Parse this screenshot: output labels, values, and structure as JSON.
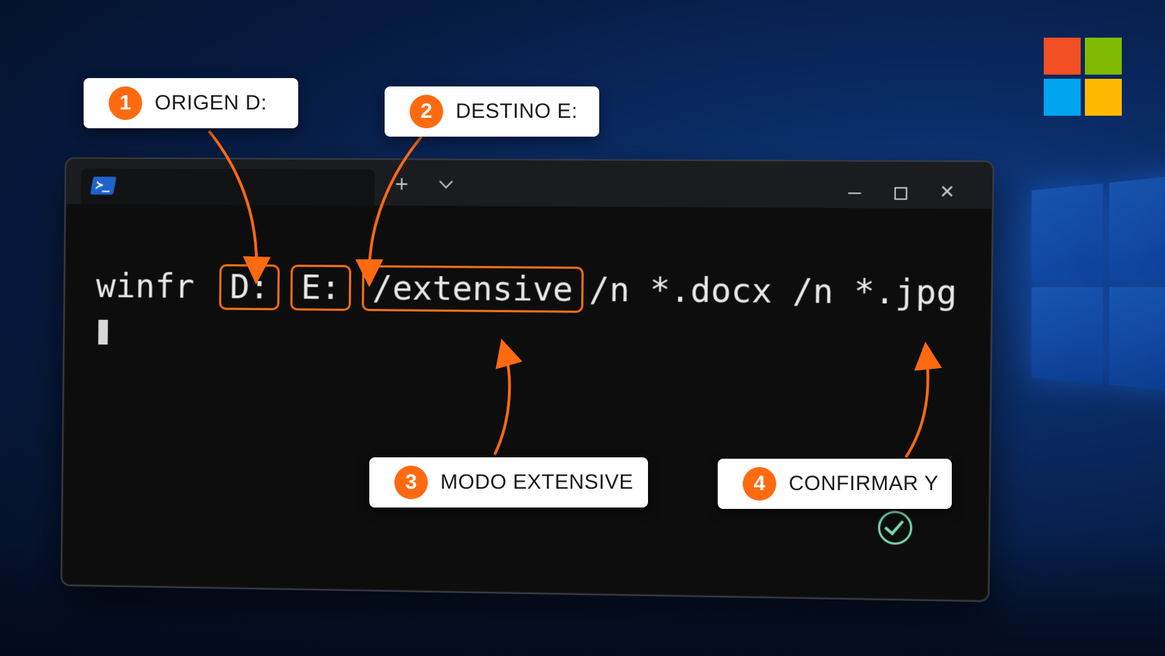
{
  "terminal": {
    "shell_icon": "powershell-icon",
    "new_tab_label": "+",
    "close_label": "✕",
    "command": {
      "program": "winfr",
      "source": "D:",
      "destination": "E:",
      "mode": "/extensive",
      "filter": "/n *.docx /n *.jpg"
    },
    "status_icon": "check-circle-icon"
  },
  "callouts": [
    {
      "number": "1",
      "text": "ORIGEN D:"
    },
    {
      "number": "2",
      "text": "DESTINO E:"
    },
    {
      "number": "3",
      "text": "MODO EXTENSIVE"
    },
    {
      "number": "4",
      "text": "CONFIRMAR Y"
    }
  ],
  "colors": {
    "accent": "#ff6a10",
    "check": "#7ddbb3",
    "ms_red": "#f25022",
    "ms_green": "#7fba00",
    "ms_blue": "#00a4ef",
    "ms_yellow": "#ffb900"
  }
}
